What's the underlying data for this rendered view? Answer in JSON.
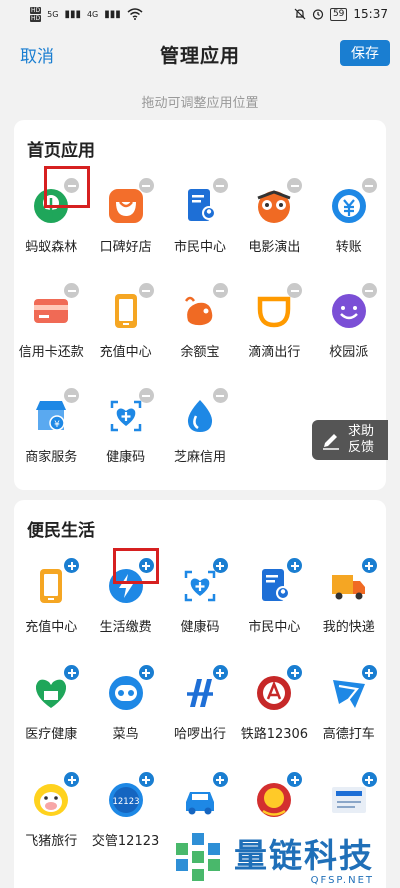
{
  "status_bar": {
    "time": "15:37",
    "network_a": "5G",
    "network_b": "4G",
    "hd": "HD",
    "battery": "59"
  },
  "header": {
    "cancel_label": "取消",
    "title": "管理应用",
    "save_label": "保存"
  },
  "hint": "拖动可调整应用位置",
  "home_section": {
    "title": "首页应用",
    "apps": [
      {
        "label": "蚂蚁森林",
        "icon": "ant-forest-icon"
      },
      {
        "label": "口碑好店",
        "icon": "koubei-icon"
      },
      {
        "label": "市民中心",
        "icon": "citizen-center-icon"
      },
      {
        "label": "电影演出",
        "icon": "movie-icon"
      },
      {
        "label": "转账",
        "icon": "transfer-icon"
      },
      {
        "label": "信用卡还款",
        "icon": "credit-card-icon"
      },
      {
        "label": "充值中心",
        "icon": "recharge-icon"
      },
      {
        "label": "余额宝",
        "icon": "yuebao-icon"
      },
      {
        "label": "滴滴出行",
        "icon": "didi-icon"
      },
      {
        "label": "校园派",
        "icon": "campus-icon"
      },
      {
        "label": "商家服务",
        "icon": "merchant-icon"
      },
      {
        "label": "健康码",
        "icon": "health-code-icon"
      },
      {
        "label": "芝麻信用",
        "icon": "sesame-credit-icon"
      }
    ]
  },
  "life_section": {
    "title": "便民生活",
    "apps": [
      {
        "label": "充值中心",
        "icon": "recharge-icon"
      },
      {
        "label": "生活缴费",
        "icon": "utility-payment-icon"
      },
      {
        "label": "健康码",
        "icon": "health-code-icon"
      },
      {
        "label": "市民中心",
        "icon": "citizen-center-icon"
      },
      {
        "label": "我的快递",
        "icon": "delivery-truck-icon"
      },
      {
        "label": "医疗健康",
        "icon": "medical-icon"
      },
      {
        "label": "菜鸟",
        "icon": "cainiao-icon"
      },
      {
        "label": "哈啰出行",
        "icon": "hello-bike-icon"
      },
      {
        "label": "铁路12306",
        "icon": "railway-icon"
      },
      {
        "label": "高德打车",
        "icon": "amap-taxi-icon"
      },
      {
        "label": "飞猪旅行",
        "icon": "fliggy-icon"
      },
      {
        "label": "交管12123",
        "icon": "traffic-12123-icon"
      },
      {
        "label": "",
        "icon": "car-icon"
      },
      {
        "label": "",
        "icon": "emblem-icon"
      },
      {
        "label": "",
        "icon": "state-council-icon"
      }
    ]
  },
  "feedback": {
    "line1": "求助",
    "line2": "反馈"
  },
  "watermark": {
    "cn": "量链科技",
    "en": "QFSP.NET"
  },
  "colors": {
    "accent": "#1a7ed1",
    "remove_badge": "#c9c9c9",
    "highlight": "#d62020"
  }
}
